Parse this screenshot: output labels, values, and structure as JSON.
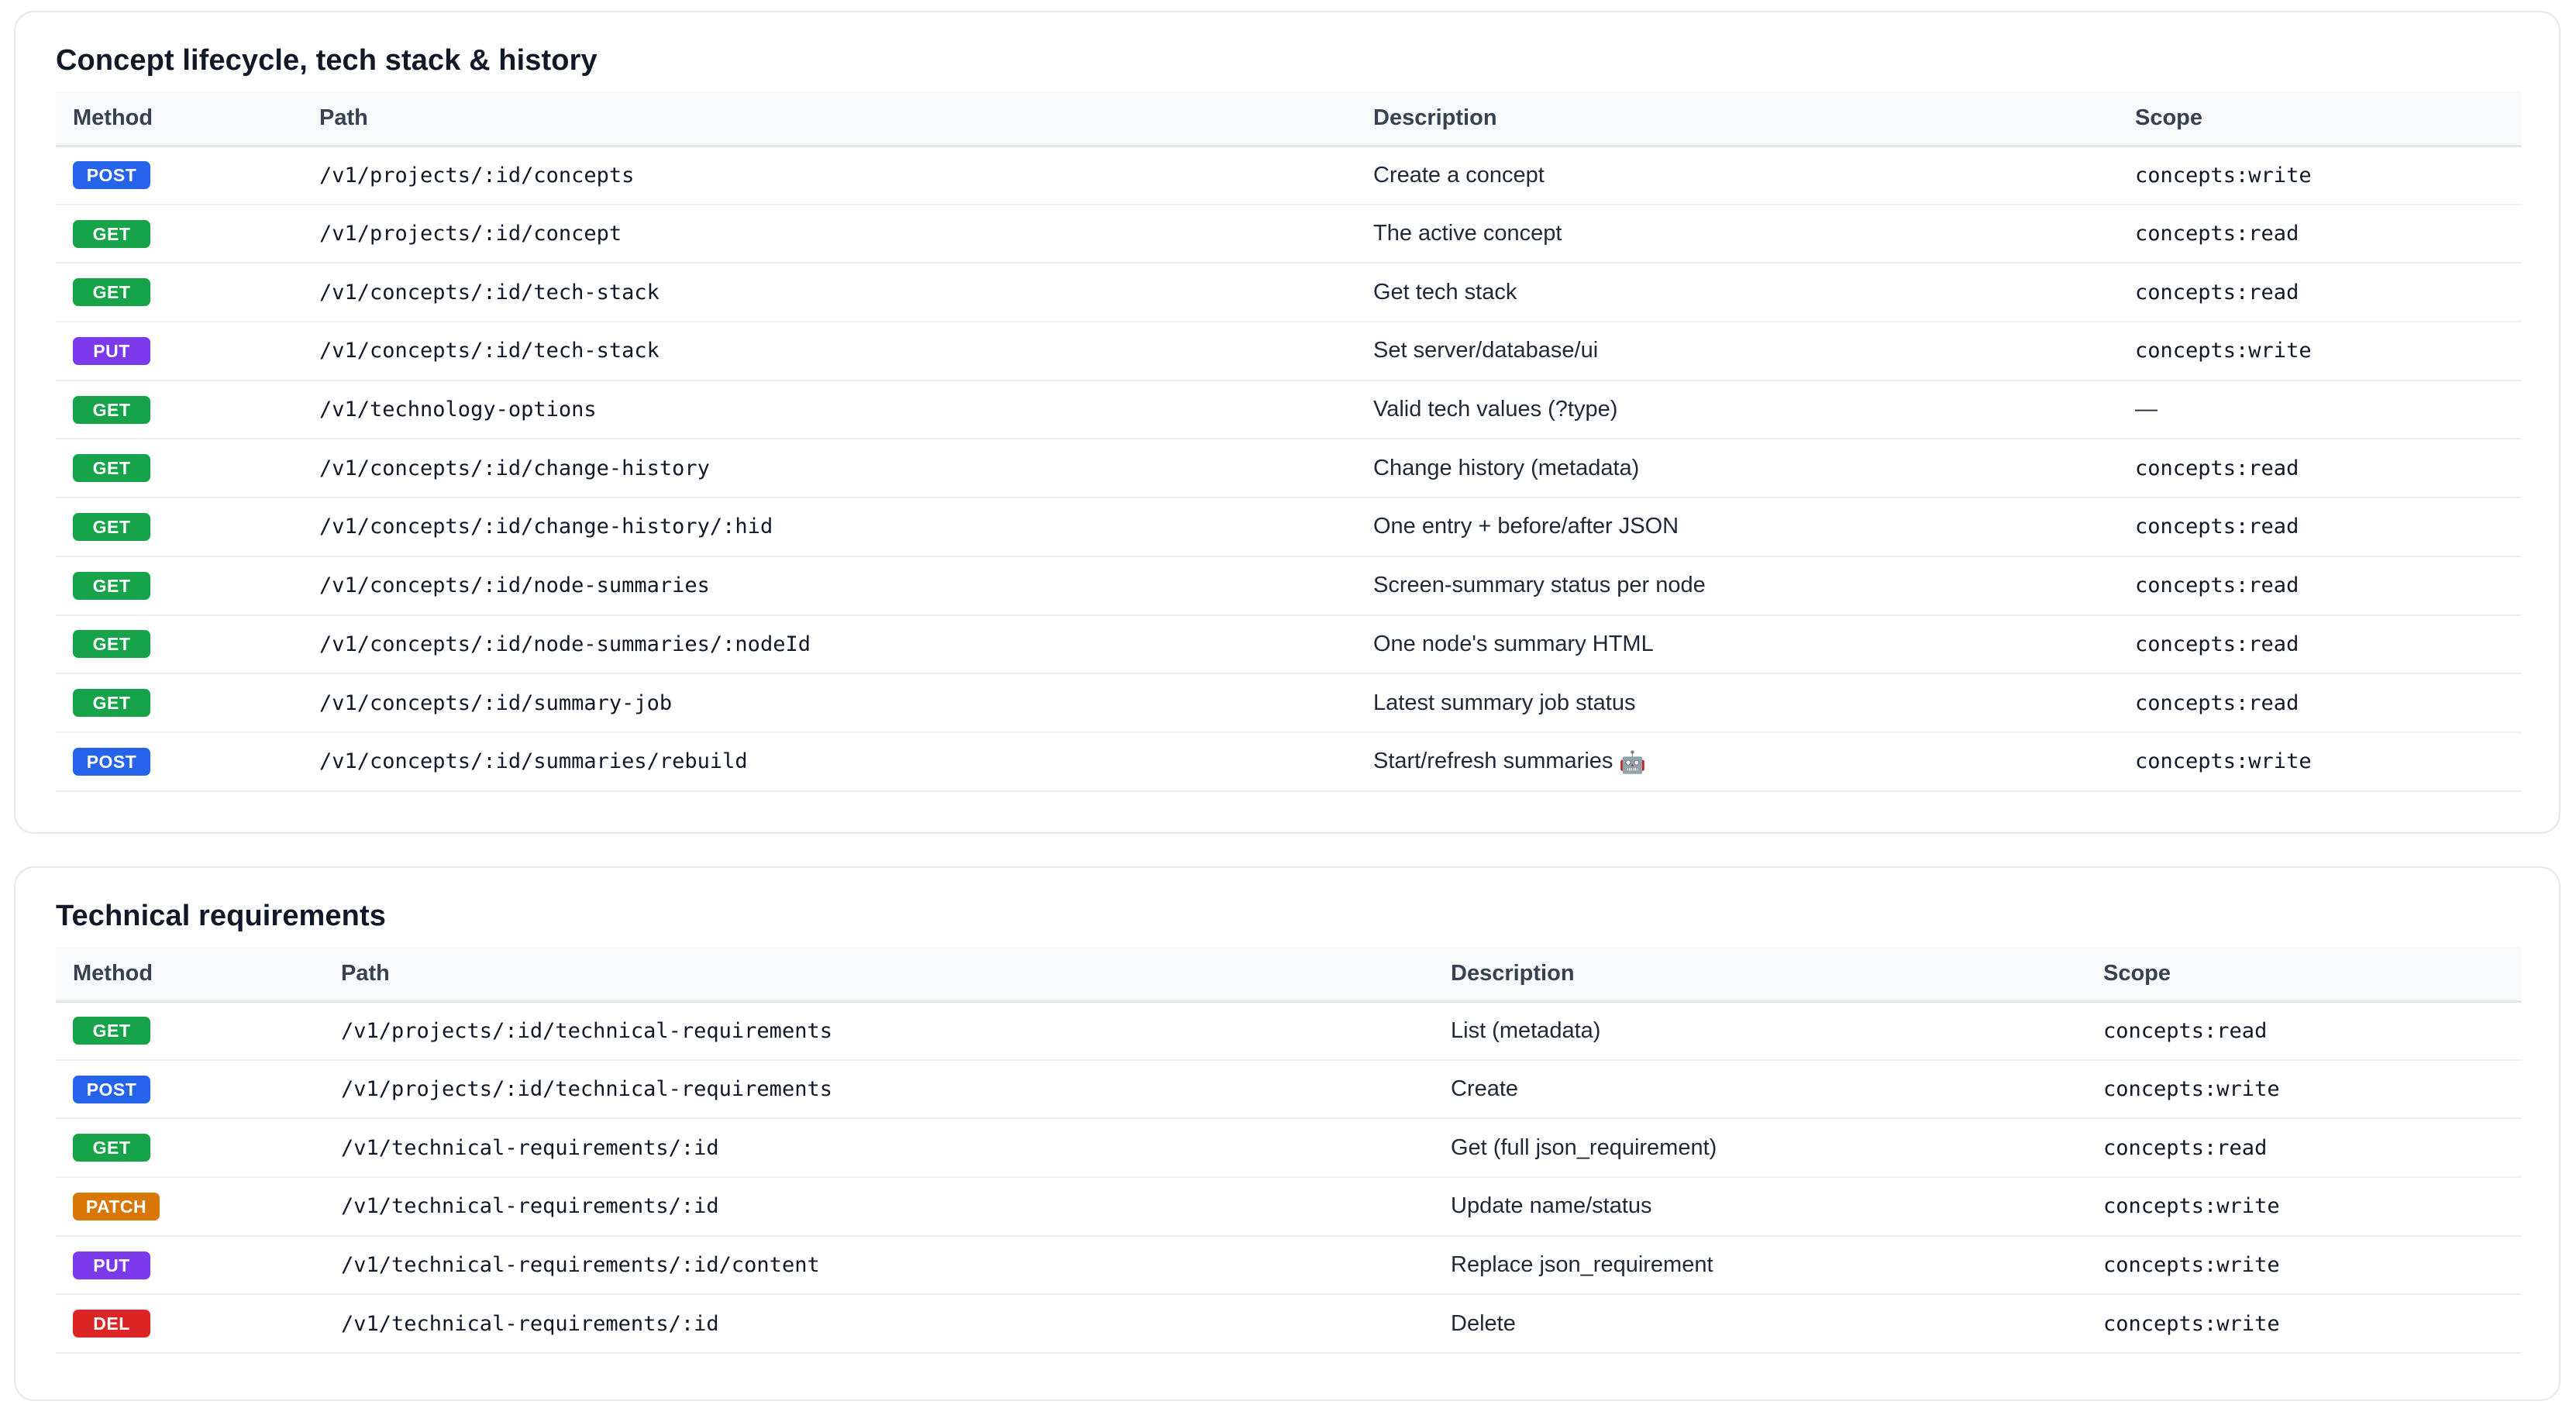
{
  "colors": {
    "POST": "#2563eb",
    "GET": "#16a34a",
    "PUT": "#7c3aed",
    "PATCH": "#d97706",
    "DEL": "#dc2626"
  },
  "sections": [
    {
      "title": "Concept lifecycle, tech stack & history",
      "headers": [
        "Method",
        "Path",
        "Description",
        "Scope"
      ],
      "rows": [
        {
          "method": "POST",
          "path": "/v1/projects/:id/concepts",
          "description": "Create a concept",
          "scope": "concepts:write"
        },
        {
          "method": "GET",
          "path": "/v1/projects/:id/concept",
          "description": "The active concept",
          "scope": "concepts:read"
        },
        {
          "method": "GET",
          "path": "/v1/concepts/:id/tech-stack",
          "description": "Get tech stack",
          "scope": "concepts:read"
        },
        {
          "method": "PUT",
          "path": "/v1/concepts/:id/tech-stack",
          "description": "Set server/database/ui",
          "scope": "concepts:write"
        },
        {
          "method": "GET",
          "path": "/v1/technology-options",
          "description": "Valid tech values (?type)",
          "scope": "—"
        },
        {
          "method": "GET",
          "path": "/v1/concepts/:id/change-history",
          "description": "Change history (metadata)",
          "scope": "concepts:read"
        },
        {
          "method": "GET",
          "path": "/v1/concepts/:id/change-history/:hid",
          "description": "One entry + before/after JSON",
          "scope": "concepts:read"
        },
        {
          "method": "GET",
          "path": "/v1/concepts/:id/node-summaries",
          "description": "Screen-summary status per node",
          "scope": "concepts:read"
        },
        {
          "method": "GET",
          "path": "/v1/concepts/:id/node-summaries/:nodeId",
          "description": "One node's summary HTML",
          "scope": "concepts:read"
        },
        {
          "method": "GET",
          "path": "/v1/concepts/:id/summary-job",
          "description": "Latest summary job status",
          "scope": "concepts:read"
        },
        {
          "method": "POST",
          "path": "/v1/concepts/:id/summaries/rebuild",
          "description": "Start/refresh summaries",
          "icon": "🤖",
          "icon_name": "robot-icon",
          "scope": "concepts:write"
        }
      ]
    },
    {
      "title": "Technical requirements",
      "headers": [
        "Method",
        "Path",
        "Description",
        "Scope"
      ],
      "rows": [
        {
          "method": "GET",
          "path": "/v1/projects/:id/technical-requirements",
          "description": "List (metadata)",
          "scope": "concepts:read"
        },
        {
          "method": "POST",
          "path": "/v1/projects/:id/technical-requirements",
          "description": "Create",
          "scope": "concepts:write"
        },
        {
          "method": "GET",
          "path": "/v1/technical-requirements/:id",
          "description": "Get (full json_requirement)",
          "scope": "concepts:read"
        },
        {
          "method": "PATCH",
          "path": "/v1/technical-requirements/:id",
          "description": "Update name/status",
          "scope": "concepts:write"
        },
        {
          "method": "PUT",
          "path": "/v1/technical-requirements/:id/content",
          "description": "Replace json_requirement",
          "scope": "concepts:write"
        },
        {
          "method": "DEL",
          "path": "/v1/technical-requirements/:id",
          "description": "Delete",
          "scope": "concepts:write"
        }
      ]
    }
  ]
}
